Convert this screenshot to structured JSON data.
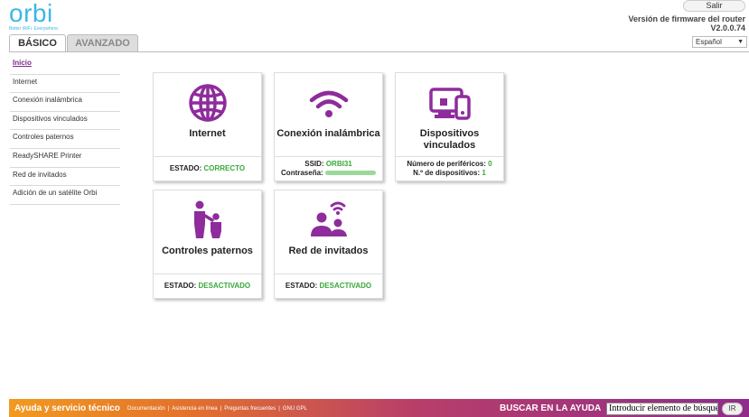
{
  "header": {
    "logo_text": "orbi",
    "logo_tagline": "Better WiFi. Everywhere.",
    "logout_label": "Salir",
    "firmware_label": "Versión de firmware del router",
    "firmware_version": "V2.0.0.74",
    "language_selected": "Español"
  },
  "tabs": [
    {
      "label": "BÁSICO",
      "active": true
    },
    {
      "label": "AVANZADO",
      "active": false
    }
  ],
  "sidebar": {
    "items": [
      {
        "label": "Inicio",
        "active": true
      },
      {
        "label": "Internet"
      },
      {
        "label": "Conexión inalámbrica"
      },
      {
        "label": "Dispositivos vinculados"
      },
      {
        "label": "Controles paternos"
      },
      {
        "label": "ReadySHARE Printer"
      },
      {
        "label": "Red de invitados"
      },
      {
        "label": "Adición de un satélite Orbi"
      }
    ]
  },
  "cards": {
    "internet": {
      "title": "Internet",
      "status_label": "ESTADO:",
      "status_value": "CORRECTO",
      "icon": "globe-icon"
    },
    "wireless": {
      "title": "Conexión inalámbrica",
      "ssid_label": "SSID:",
      "ssid_value": "ORBI31",
      "password_label": "Contraseña:",
      "icon": "wifi-icon"
    },
    "devices": {
      "title_line1": "Dispositivos",
      "title_line2": "vinculados",
      "peripherals_label": "Número de periféricos:",
      "peripherals_value": "0",
      "devices_label": "N.º de dispositivos:",
      "devices_value": "1",
      "icon": "devices-icon"
    },
    "parental": {
      "title": "Controles paternos",
      "status_label": "ESTADO:",
      "status_value": "DESACTIVADO",
      "icon": "parent-child-icon"
    },
    "guest": {
      "title": "Red de invitados",
      "status_label": "ESTADO:",
      "status_value": "DESACTIVADO",
      "icon": "guest-network-icon"
    }
  },
  "footer": {
    "title": "Ayuda y servicio técnico",
    "links": [
      "Documentación",
      "Asistencia en línea",
      "Preguntas frecuentes",
      "GNU GPL"
    ],
    "search_label": "BUSCAR EN LA AYUDA",
    "search_value": "Introducir elemento de búsque",
    "go_label": "IR"
  },
  "colors": {
    "brand_blue": "#3db7e4",
    "accent_purple": "#8e2c9b",
    "status_green": "#3aa83a"
  }
}
